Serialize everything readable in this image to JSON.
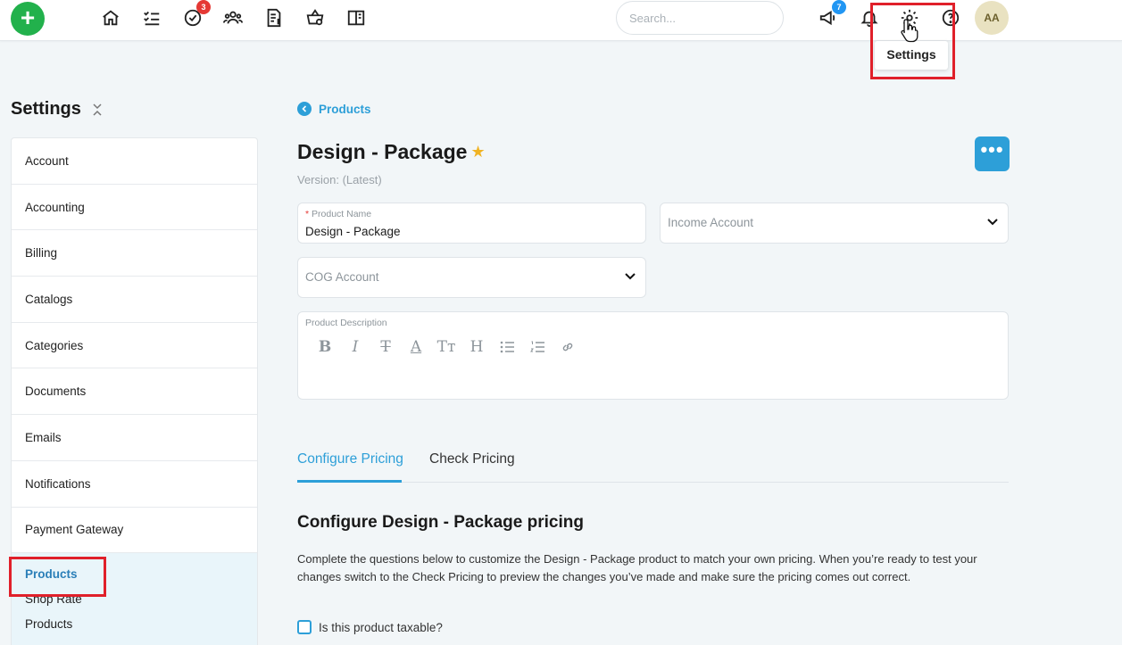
{
  "topbar": {
    "add_label": "+",
    "tasks_badge": "3",
    "announcements_badge": "7",
    "search_placeholder": "Search...",
    "avatar_initials": "AA",
    "settings_tooltip": "Settings",
    "icons": [
      "home-icon",
      "task-list-icon",
      "check-circle-icon",
      "team-icon",
      "invoice-icon",
      "basket-icon",
      "book-icon",
      "megaphone-icon",
      "bell-icon",
      "gear-icon",
      "help-icon"
    ]
  },
  "sidebar": {
    "title": "Settings",
    "items": [
      {
        "label": "Account"
      },
      {
        "label": "Accounting"
      },
      {
        "label": "Billing"
      },
      {
        "label": "Catalogs"
      },
      {
        "label": "Categories"
      },
      {
        "label": "Documents"
      },
      {
        "label": "Emails"
      },
      {
        "label": "Notifications"
      },
      {
        "label": "Payment Gateway"
      }
    ],
    "active_item": "Products",
    "sub_items": [
      "Shop Rate",
      "Products"
    ]
  },
  "main": {
    "breadcrumb": "Products",
    "title": "Design - Package",
    "starred": true,
    "version": "Version: (Latest)",
    "more_label": "•••",
    "product_name_label": "Product Name",
    "product_name_required": "*",
    "product_name_value": "Design - Package",
    "income_account_placeholder": "Income Account",
    "cog_account_placeholder": "COG Account",
    "description_label": "Product Description",
    "toolbar": [
      "B",
      "I",
      "T",
      "A",
      "Tт",
      "H"
    ],
    "tabs": [
      "Configure Pricing",
      "Check Pricing"
    ],
    "active_tab": "Configure Pricing",
    "section_title": "Configure Design - Package pricing",
    "section_desc": "Complete the questions below to customize the Design - Package product to match your own pricing. When you’re ready to test your changes switch to the Check Pricing to preview the changes you’ve made and make sure the pricing comes out correct.",
    "taxable_label": "Is this product taxable?"
  },
  "colors": {
    "accent": "#2d9fd8",
    "add_button": "#22b14c",
    "highlight_box": "#e0202a",
    "badge_red": "#e53935",
    "badge_blue": "#2196f3",
    "star": "#f0b323"
  }
}
